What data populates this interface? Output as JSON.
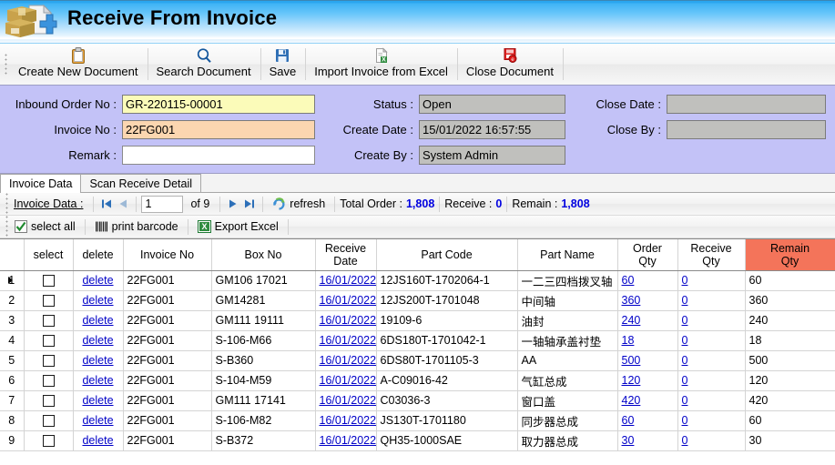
{
  "window": {
    "title": "Receive From Invoice",
    "icon": "boxes-plus-icon"
  },
  "toolbar": {
    "items": [
      {
        "label": "Create New Document",
        "icon": "clipboard-icon"
      },
      {
        "label": "Search Document",
        "icon": "magnifier-icon"
      },
      {
        "label": "Save",
        "icon": "floppy-disk-icon"
      },
      {
        "label": "Import Invoice from Excel",
        "icon": "excel-import-icon"
      },
      {
        "label": "Close Document",
        "icon": "close-document-icon"
      }
    ]
  },
  "form": {
    "inbound_order_no": {
      "label": "Inbound Order No :",
      "value": "GR-220115-00001"
    },
    "invoice_no": {
      "label": "Invoice No :",
      "value": "22FG001"
    },
    "remark": {
      "label": "Remark :",
      "value": ""
    },
    "status": {
      "label": "Status :",
      "value": "Open"
    },
    "create_date": {
      "label": "Create Date :",
      "value": "15/01/2022 16:57:55"
    },
    "create_by": {
      "label": "Create By :",
      "value": "System Admin"
    },
    "close_date": {
      "label": "Close Date :",
      "value": ""
    },
    "close_by": {
      "label": "Close By :",
      "value": ""
    }
  },
  "tabs": [
    {
      "label": "Invoice Data",
      "active": true
    },
    {
      "label": "Scan Receive Detail",
      "active": false
    }
  ],
  "nav": {
    "title": "Invoice Data :",
    "first_icon": "first-page-icon",
    "prev_icon": "prev-page-icon",
    "page_value": "1",
    "of_label": "of 9",
    "next_icon": "next-page-icon",
    "last_icon": "last-page-icon",
    "refresh_label": "refresh",
    "refresh_icon": "refresh-icon",
    "total_order_label": "Total Order :",
    "total_order_value": "1,808",
    "receive_label": "Receive :",
    "receive_value": "0",
    "remain_label": "Remain :",
    "remain_value": "1,808"
  },
  "actions": [
    {
      "label": "select all",
      "icon": "checkbox-check-icon"
    },
    {
      "label": "print barcode",
      "icon": "barcode-icon"
    },
    {
      "label": "Export Excel",
      "icon": "excel-icon"
    }
  ],
  "grid": {
    "columns": [
      {
        "key": "rownum",
        "label": ""
      },
      {
        "key": "select",
        "label": "select"
      },
      {
        "key": "delete",
        "label": "delete"
      },
      {
        "key": "invoice",
        "label": "Invoice No"
      },
      {
        "key": "box",
        "label": "Box No"
      },
      {
        "key": "rdate",
        "label": "Receive\nDate"
      },
      {
        "key": "pcode",
        "label": "Part Code"
      },
      {
        "key": "pname",
        "label": "Part Name"
      },
      {
        "key": "oqty",
        "label": "Order\nQty"
      },
      {
        "key": "rqty",
        "label": "Receive\nQty"
      },
      {
        "key": "remqty",
        "label": "Remain\nQty"
      }
    ],
    "delete_label": "delete",
    "rows": [
      {
        "rownum": "1",
        "selected": false,
        "current": true,
        "invoice": "22FG001",
        "box": "GM106 17021",
        "rdate": "16/01/2022",
        "pcode": "12JS160T-1702064-1",
        "pname": "一二三四档拨叉轴",
        "oqty": "60",
        "rqty": "0",
        "remqty": "60"
      },
      {
        "rownum": "2",
        "selected": false,
        "current": false,
        "invoice": "22FG001",
        "box": "GM14281",
        "rdate": "16/01/2022",
        "pcode": "12JS200T-1701048",
        "pname": "中间轴",
        "oqty": "360",
        "rqty": "0",
        "remqty": "360"
      },
      {
        "rownum": "3",
        "selected": false,
        "current": false,
        "invoice": "22FG001",
        "box": "GM111 19111",
        "rdate": "16/01/2022",
        "pcode": "19109-6",
        "pname": "油封",
        "oqty": "240",
        "rqty": "0",
        "remqty": "240"
      },
      {
        "rownum": "4",
        "selected": false,
        "current": false,
        "invoice": "22FG001",
        "box": "S-106-M66",
        "rdate": "16/01/2022",
        "pcode": "6DS180T-1701042-1",
        "pname": "一轴轴承盖衬垫",
        "oqty": "18",
        "rqty": "0",
        "remqty": "18"
      },
      {
        "rownum": "5",
        "selected": false,
        "current": false,
        "invoice": "22FG001",
        "box": "S-B360",
        "rdate": "16/01/2022",
        "pcode": "6DS80T-1701105-3",
        "pname": "AA",
        "oqty": "500",
        "rqty": "0",
        "remqty": "500"
      },
      {
        "rownum": "6",
        "selected": false,
        "current": false,
        "invoice": "22FG001",
        "box": "S-104-M59",
        "rdate": "16/01/2022",
        "pcode": "A-C09016-42",
        "pname": "气缸总成",
        "oqty": "120",
        "rqty": "0",
        "remqty": "120"
      },
      {
        "rownum": "7",
        "selected": false,
        "current": false,
        "invoice": "22FG001",
        "box": "GM111 17141",
        "rdate": "16/01/2022",
        "pcode": "C03036-3",
        "pname": "窗口盖",
        "oqty": "420",
        "rqty": "0",
        "remqty": "420"
      },
      {
        "rownum": "8",
        "selected": false,
        "current": false,
        "invoice": "22FG001",
        "box": "S-106-M82",
        "rdate": "16/01/2022",
        "pcode": "JS130T-1701180",
        "pname": "同步器总成",
        "oqty": "60",
        "rqty": "0",
        "remqty": "60"
      },
      {
        "rownum": "9",
        "selected": false,
        "current": false,
        "invoice": "22FG001",
        "box": "S-B372",
        "rdate": "16/01/2022",
        "pcode": "QH35-1000SAE",
        "pname": "取力器总成",
        "oqty": "30",
        "rqty": "0",
        "remqty": "30"
      }
    ]
  },
  "colors": {
    "banner_blue": "#2aa6ef",
    "form_panel": "#c3c2f7",
    "remain_red": "#f4745a",
    "link_blue": "#0000c8",
    "stat_blue": "#0000e0",
    "field_yellow": "#fbfbb9",
    "field_peach": "#fbd6b0",
    "field_gray": "#c0c0bd"
  }
}
